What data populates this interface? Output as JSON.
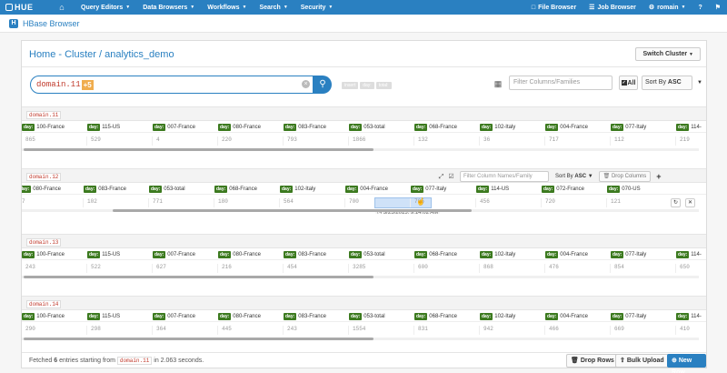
{
  "nav": {
    "logo": "HUE",
    "items": [
      {
        "label": "Query Editors"
      },
      {
        "label": "Data Browsers"
      },
      {
        "label": "Workflows"
      },
      {
        "label": "Search"
      },
      {
        "label": "Security"
      }
    ],
    "right": [
      {
        "label": "File Browser"
      },
      {
        "label": "Job Browser"
      },
      {
        "label": "romain"
      }
    ]
  },
  "app": {
    "title": "HBase Browser"
  },
  "breadcrumb": "Home - Cluster / analytics_demo",
  "switch_cluster": "Switch Cluster",
  "search": {
    "value": "domain.11",
    "badge": "+5",
    "hints": [
      "insert",
      "day:",
      "total:"
    ]
  },
  "filter_placeholder": "Filter Columns/Families",
  "all_label": "All",
  "sort": {
    "label": "Sort By",
    "value": "ASC"
  },
  "rows": [
    {
      "key": "domain.11",
      "columns": [
        {
          "family": "day:",
          "qualifier": "100-France",
          "value": "865"
        },
        {
          "family": "day:",
          "qualifier": "115-US",
          "value": "529"
        },
        {
          "family": "day:",
          "qualifier": "007-France",
          "value": "4"
        },
        {
          "family": "day:",
          "qualifier": "080-France",
          "value": "220"
        },
        {
          "family": "day:",
          "qualifier": "083-France",
          "value": "793"
        },
        {
          "family": "day:",
          "qualifier": "053-total",
          "value": "1866"
        },
        {
          "family": "day:",
          "qualifier": "068-France",
          "value": "132"
        },
        {
          "family": "day:",
          "qualifier": "102-Italy",
          "value": "36"
        },
        {
          "family": "day:",
          "qualifier": "004-France",
          "value": "717"
        },
        {
          "family": "day:",
          "qualifier": "077-Italy",
          "value": "112"
        },
        {
          "family": "day:",
          "qualifier": "114-",
          "value": "219"
        }
      ]
    },
    {
      "key": "domain.12",
      "filter_placeholder": "Filter Column Names/Family",
      "drop_columns": "Drop Columns",
      "tooltip": "3/25/2015, 9:14:02 AM",
      "columns": [
        {
          "family": "day:",
          "qualifier": "080-France",
          "value": "7"
        },
        {
          "family": "day:",
          "qualifier": "083-France",
          "value": "102"
        },
        {
          "family": "day:",
          "qualifier": "053-total",
          "value": "771"
        },
        {
          "family": "day:",
          "qualifier": "068-France",
          "value": "180"
        },
        {
          "family": "day:",
          "qualifier": "102-Italy",
          "value": "564"
        },
        {
          "family": "day:",
          "qualifier": "004-France",
          "value": "700"
        },
        {
          "family": "day:",
          "qualifier": "077-Italy",
          "value": "705"
        },
        {
          "family": "day:",
          "qualifier": "114-US",
          "value": "456"
        },
        {
          "family": "day:",
          "qualifier": "072-France",
          "value": "720"
        },
        {
          "family": "day:",
          "qualifier": "070-US",
          "value": "121"
        }
      ]
    },
    {
      "key": "domain.13",
      "columns": [
        {
          "family": "day:",
          "qualifier": "100-France",
          "value": "243"
        },
        {
          "family": "day:",
          "qualifier": "115-US",
          "value": "522"
        },
        {
          "family": "day:",
          "qualifier": "007-France",
          "value": "627"
        },
        {
          "family": "day:",
          "qualifier": "080-France",
          "value": "216"
        },
        {
          "family": "day:",
          "qualifier": "083-France",
          "value": "454"
        },
        {
          "family": "day:",
          "qualifier": "053-total",
          "value": "3285"
        },
        {
          "family": "day:",
          "qualifier": "068-France",
          "value": "600"
        },
        {
          "family": "day:",
          "qualifier": "102-Italy",
          "value": "868"
        },
        {
          "family": "day:",
          "qualifier": "004-France",
          "value": "476"
        },
        {
          "family": "day:",
          "qualifier": "077-Italy",
          "value": "854"
        },
        {
          "family": "day:",
          "qualifier": "114-",
          "value": "650"
        }
      ]
    },
    {
      "key": "domain.14",
      "columns": [
        {
          "family": "day:",
          "qualifier": "100-France",
          "value": "290"
        },
        {
          "family": "day:",
          "qualifier": "115-US",
          "value": "298"
        },
        {
          "family": "day:",
          "qualifier": "007-France",
          "value": "364"
        },
        {
          "family": "day:",
          "qualifier": "080-France",
          "value": "445"
        },
        {
          "family": "day:",
          "qualifier": "083-France",
          "value": "243"
        },
        {
          "family": "day:",
          "qualifier": "053-total",
          "value": "1554"
        },
        {
          "family": "day:",
          "qualifier": "068-France",
          "value": "831"
        },
        {
          "family": "day:",
          "qualifier": "102-Italy",
          "value": "942"
        },
        {
          "family": "day:",
          "qualifier": "004-France",
          "value": "466"
        },
        {
          "family": "day:",
          "qualifier": "077-Italy",
          "value": "669"
        },
        {
          "family": "day:",
          "qualifier": "114-",
          "value": "410"
        }
      ]
    }
  ],
  "footer": {
    "prefix": "Fetched",
    "count": "6",
    "middle": "entries starting from",
    "key": "domain.11",
    "suffix": "in 2.063 seconds.",
    "drop_rows": "Drop Rows",
    "bulk_upload": "Bulk Upload",
    "new_row": "New Row"
  },
  "colors": {
    "accent": "#2a80c1",
    "family": "#3c7a1f",
    "rowkey": "#c0392b",
    "badge": "#f0ad4e"
  }
}
